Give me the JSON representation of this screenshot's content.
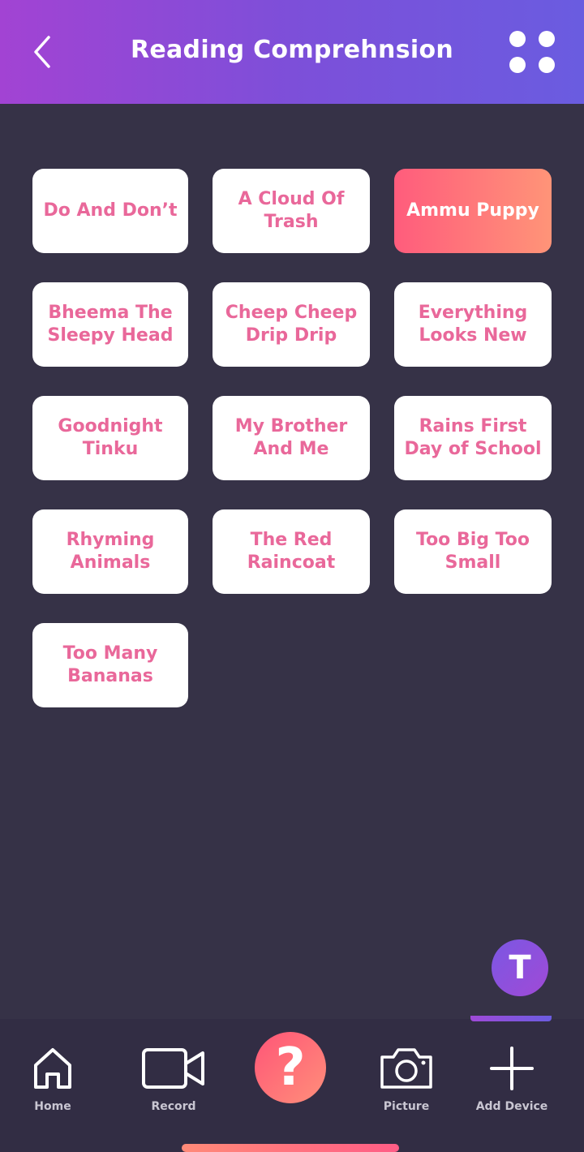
{
  "header": {
    "title": "Reading Comprehnsion"
  },
  "stories": [
    {
      "label": "Do And Don’t",
      "selected": false
    },
    {
      "label": "A Cloud Of Trash",
      "selected": false
    },
    {
      "label": "Ammu Puppy",
      "selected": true
    },
    {
      "label": "Bheema The Sleepy Head",
      "selected": false
    },
    {
      "label": "Cheep Cheep Drip Drip",
      "selected": false
    },
    {
      "label": "Everything Looks New",
      "selected": false
    },
    {
      "label": "Goodnight Tinku",
      "selected": false
    },
    {
      "label": "My Brother And Me",
      "selected": false
    },
    {
      "label": "Rains First Day of School",
      "selected": false
    },
    {
      "label": "Rhyming Animals",
      "selected": false
    },
    {
      "label": "The Red Raincoat",
      "selected": false
    },
    {
      "label": "Too Big Too Small",
      "selected": false
    },
    {
      "label": "Too Many Bananas",
      "selected": false
    }
  ],
  "avatar": {
    "initial": "T"
  },
  "nav": {
    "home": "Home",
    "record": "Record",
    "help": "?",
    "picture": "Picture",
    "add_device": "Add Device"
  },
  "colors": {
    "header_start": "#a243d3",
    "header_end": "#6a5ce0",
    "tile_text": "#e9689a",
    "accent_start": "#ff5c7c",
    "accent_end": "#ff9478",
    "background": "#363247"
  }
}
